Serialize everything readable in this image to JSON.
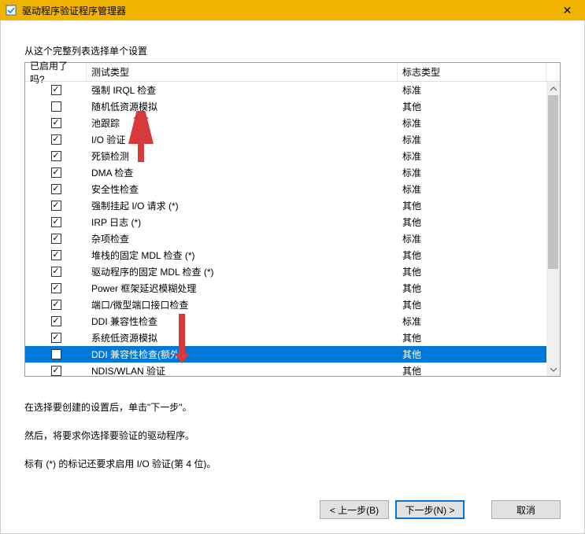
{
  "titlebar": {
    "title": "驱动程序验证程序管理器",
    "close_symbol": "✕"
  },
  "section_label": "从这个完整列表选择单个设置",
  "columns": {
    "enabled": "已启用了吗?",
    "testtype": "测试类型",
    "flagtype": "标志类型"
  },
  "flag_values": {
    "standard": "标准",
    "other": "其他"
  },
  "rows": [
    {
      "checked": true,
      "test": "强制 IRQL 检查",
      "flag": "标准",
      "selected": false
    },
    {
      "checked": false,
      "test": "随机低资源模拟",
      "flag": "其他",
      "selected": false
    },
    {
      "checked": true,
      "test": "池跟踪",
      "flag": "标准",
      "selected": false
    },
    {
      "checked": true,
      "test": "I/O 验证",
      "flag": "标准",
      "selected": false
    },
    {
      "checked": true,
      "test": "死锁检测",
      "flag": "标准",
      "selected": false
    },
    {
      "checked": true,
      "test": "DMA 检查",
      "flag": "标准",
      "selected": false
    },
    {
      "checked": true,
      "test": "安全性检查",
      "flag": "标准",
      "selected": false
    },
    {
      "checked": true,
      "test": "强制挂起 I/O 请求 (*)",
      "flag": "其他",
      "selected": false
    },
    {
      "checked": true,
      "test": "IRP 日志 (*)",
      "flag": "其他",
      "selected": false
    },
    {
      "checked": true,
      "test": "杂项检查",
      "flag": "标准",
      "selected": false
    },
    {
      "checked": true,
      "test": "堆栈的固定 MDL 检查 (*)",
      "flag": "其他",
      "selected": false
    },
    {
      "checked": true,
      "test": "驱动程序的固定 MDL 检查 (*)",
      "flag": "其他",
      "selected": false
    },
    {
      "checked": true,
      "test": "Power 框架延迟模糊处理",
      "flag": "其他",
      "selected": false
    },
    {
      "checked": true,
      "test": "端口/微型端口接口检查",
      "flag": "其他",
      "selected": false
    },
    {
      "checked": true,
      "test": "DDI 兼容性检查",
      "flag": "标准",
      "selected": false
    },
    {
      "checked": true,
      "test": "系统低资源模拟",
      "flag": "其他",
      "selected": false
    },
    {
      "checked": false,
      "test": "DDI 兼容性检查(额外)",
      "flag": "其他",
      "selected": true
    },
    {
      "checked": true,
      "test": "NDIS/WLAN 验证",
      "flag": "其他",
      "selected": false
    }
  ],
  "info": {
    "line1": "在选择要创建的设置后，单击\"下一步\"。",
    "line2": "然后，将要求你选择要验证的驱动程序。",
    "line3": "标有 (*) 的标记还要求启用 I/O 验证(第 4 位)。"
  },
  "buttons": {
    "back": "< 上一步(B)",
    "next": "下一步(N) >",
    "cancel": "取消"
  },
  "annotation": {
    "arrow_color": "#d73a3a"
  }
}
